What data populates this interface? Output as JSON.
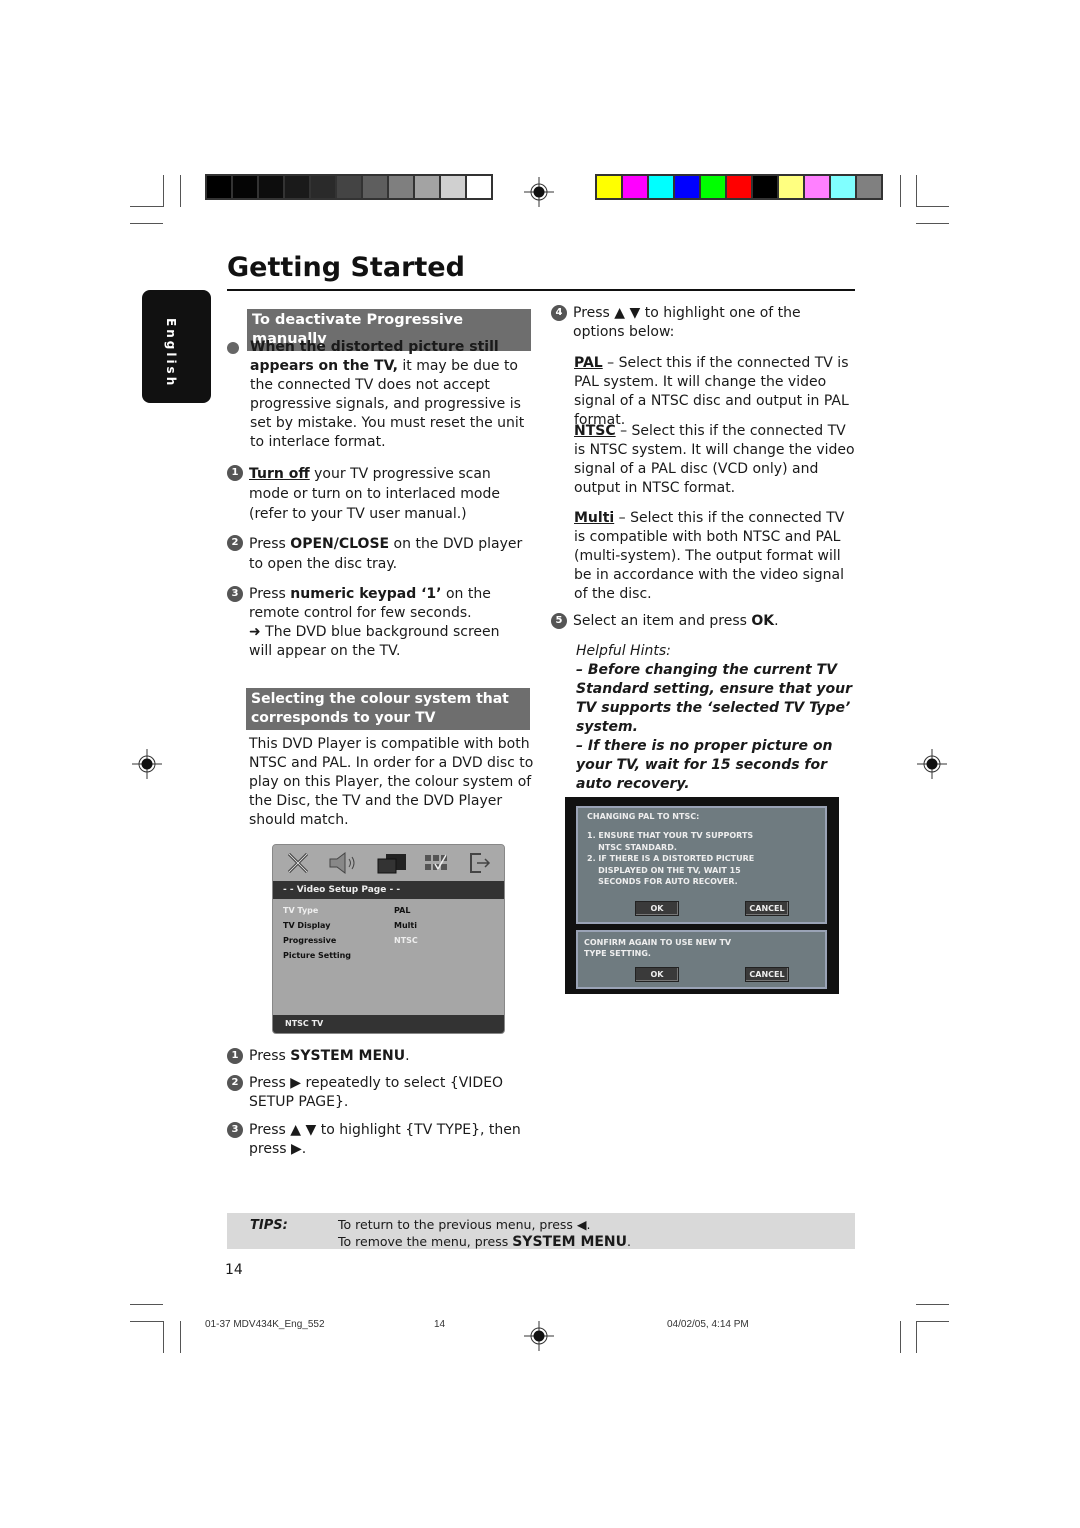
{
  "print_marks": {
    "grayscale_swatches": [
      "#000000",
      "#050505",
      "#0d0d0d",
      "#1a1a1a",
      "#2a2a2a",
      "#444444",
      "#5e5e5e",
      "#7f7f7f",
      "#a3a3a3",
      "#d0d0d0",
      "#ffffff"
    ],
    "color_swatches": [
      "#ffff00",
      "#ff00ff",
      "#00ffff",
      "#0000ff",
      "#00ff00",
      "#ff0000",
      "#000000",
      "#ffff80",
      "#ff80ff",
      "#80ffff",
      "#808080"
    ]
  },
  "header": {
    "title": "Getting Started",
    "language_tab": "English"
  },
  "left_column": {
    "section1": {
      "heading": "To deactivate Progressive manually",
      "bullet_bold": "When the distorted picture still appears on the TV,",
      "bullet_text": " it may be due to the connected TV does not accept progressive signals, and progressive is set by mistake.  You must reset the unit to interlace format.",
      "steps": [
        {
          "num": "1",
          "bold": "Turn off",
          "text": " your TV progressive scan mode or turn on to interlaced mode (refer to your TV user manual.)"
        },
        {
          "num": "2",
          "pre": "Press ",
          "bold": "OPEN/CLOSE",
          "text": " on the DVD player to open the disc tray."
        },
        {
          "num": "3",
          "pre": "Press ",
          "bold": "numeric keypad ‘1’",
          "text": " on the remote control for few seconds.",
          "result": "➜   The DVD blue background screen will appear on the TV."
        }
      ]
    },
    "section2": {
      "heading": "Selecting the colour system that corresponds to your TV",
      "intro": "This DVD Player is compatible with both NTSC and PAL. In order for a DVD disc to play on this Player, the colour system of the Disc, the TV and the DVD Player should match.",
      "steps": [
        {
          "num": "1",
          "pre": "Press ",
          "bold": "SYSTEM MENU",
          "text": "."
        },
        {
          "num": "2",
          "pre": "Press ▶ repeatedly to select {VIDEO SETUP PAGE}."
        },
        {
          "num": "3",
          "pre": "Press ▲ ▼ to highlight {TV TYPE}, then press ▶."
        }
      ]
    }
  },
  "osd_menu": {
    "icons": [
      "setup-tools-icon",
      "speaker-icon",
      "video-screens-icon",
      "preference-grid-icon",
      "exit-icon"
    ],
    "page_title": "- -   Video Setup Page   - -",
    "items": [
      {
        "label": "TV Type",
        "value": "PAL",
        "label_highlight": true,
        "value_highlight": false
      },
      {
        "label": "TV Display",
        "value": "Multi",
        "label_highlight": false,
        "value_highlight": false
      },
      {
        "label": "Progressive",
        "value": "NTSC",
        "label_highlight": false,
        "value_highlight": true
      },
      {
        "label": "Picture Setting",
        "value": "",
        "label_highlight": false,
        "value_highlight": false
      }
    ],
    "footer": "NTSC TV"
  },
  "right_column": {
    "step4": {
      "num": "4",
      "text": "Press ▲ ▼ to highlight one of the options below:"
    },
    "options": [
      {
        "name": "PAL",
        "text": " – Select this if the connected TV is PAL system. It will change the video signal of a NTSC disc and output in PAL format."
      },
      {
        "name": "NTSC",
        "text": " – Select this if the connected TV is NTSC system. It will change the video signal of a PAL disc (VCD only) and output in NTSC format."
      },
      {
        "name": "Multi",
        "text": " – Select this if the connected TV is compatible with both NTSC and PAL (multi-system). The output format will be in accordance with the video signal of the disc."
      }
    ],
    "step5": {
      "num": "5",
      "pre": "Select an item and press ",
      "bold": "OK",
      "text": "."
    },
    "hints": {
      "title": "Helpful Hints:",
      "items": [
        "–    Before changing the current TV Standard setting, ensure that your TV supports the ‘selected TV Type’ system.",
        "–    If there is no proper picture on your TV, wait for 15 seconds for auto recovery."
      ]
    }
  },
  "dialog": {
    "panel1": {
      "title": "CHANGING PAL TO NTSC:",
      "lines": [
        "1. ENSURE THAT YOUR TV SUPPORTS",
        "    NTSC STANDARD.",
        "2. IF THERE IS A DISTORTED PICTURE",
        "    DISPLAYED ON THE TV, WAIT 15",
        "    SECONDS FOR AUTO RECOVER."
      ],
      "ok": "OK",
      "cancel": "CANCEL"
    },
    "panel2": {
      "lines": [
        "CONFIRM AGAIN TO USE NEW TV",
        "TYPE SETTING."
      ],
      "ok": "OK",
      "cancel": "CANCEL"
    }
  },
  "tips": {
    "label": "TIPS:",
    "line1_pre": "To return to the previous menu, press ◀.",
    "line2_pre": "To remove the menu, press ",
    "line2_bold": "SYSTEM MENU",
    "line2_post": "."
  },
  "page_number": "14",
  "print_footer": {
    "file": "01-37 MDV434K_Eng_552",
    "page": "14",
    "date": "04/02/05, 4:14 PM"
  }
}
